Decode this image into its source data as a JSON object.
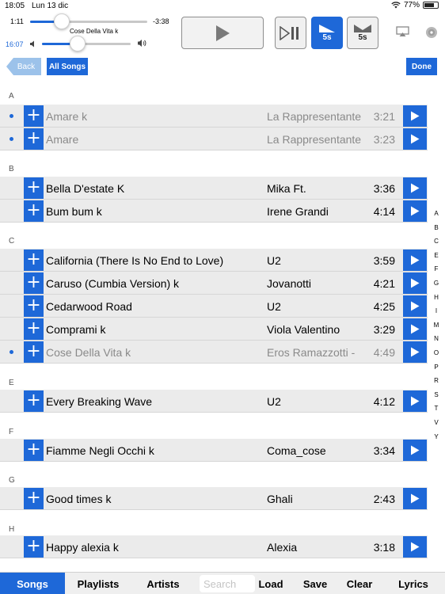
{
  "status": {
    "time": "18:05",
    "date": "Lun 13 dic",
    "battery": "77%",
    "battery_level": 0.77
  },
  "player": {
    "elapsed": "1:11",
    "remaining": "-3:38",
    "progress": 0.27,
    "now_playing": "Cose Della Vita k",
    "clock": "16:07",
    "volume": 0.4,
    "skip_back_label": "5s",
    "skip_forward_label": "5s"
  },
  "nav": {
    "back_label": "Back",
    "all_songs_label": "All Songs",
    "done_label": "Done"
  },
  "sections": [
    {
      "letter": "A",
      "songs": [
        {
          "title": "Amare k",
          "artist": "La Rappresentante",
          "duration": "3:21",
          "playing": true
        },
        {
          "title": "Amare",
          "artist": "La Rappresentante",
          "duration": "3:23",
          "playing": true
        }
      ]
    },
    {
      "letter": "B",
      "songs": [
        {
          "title": "Bella D'estate K",
          "artist": "Mika Ft.",
          "duration": "3:36",
          "playing": false
        },
        {
          "title": "Bum bum k",
          "artist": "Irene Grandi",
          "duration": "4:14",
          "playing": false
        }
      ]
    },
    {
      "letter": "C",
      "songs": [
        {
          "title": "California (There Is No End to Love)",
          "artist": "U2",
          "duration": "3:59",
          "playing": false
        },
        {
          "title": "Caruso (Cumbia Version) k",
          "artist": "Jovanotti",
          "duration": "4:21",
          "playing": false
        },
        {
          "title": "Cedarwood Road",
          "artist": "U2",
          "duration": "4:25",
          "playing": false
        },
        {
          "title": "Comprami k",
          "artist": "Viola Valentino",
          "duration": "3:29",
          "playing": false
        },
        {
          "title": "Cose Della Vita k",
          "artist": "Eros Ramazzotti -",
          "duration": "4:49",
          "playing": true
        }
      ]
    },
    {
      "letter": "E",
      "songs": [
        {
          "title": "Every Breaking Wave",
          "artist": "U2",
          "duration": "4:12",
          "playing": false
        }
      ]
    },
    {
      "letter": "F",
      "songs": [
        {
          "title": "Fiamme Negli Occhi k",
          "artist": "Coma_cose",
          "duration": "3:34",
          "playing": false
        }
      ]
    },
    {
      "letter": "G",
      "songs": [
        {
          "title": "Good times k",
          "artist": "Ghali",
          "duration": "2:43",
          "playing": false
        }
      ]
    },
    {
      "letter": "H",
      "songs": [
        {
          "title": "Happy alexia k",
          "artist": "Alexia",
          "duration": "3:18",
          "playing": false
        }
      ]
    }
  ],
  "index_letters": [
    "A",
    "B",
    "C",
    "E",
    "F",
    "G",
    "H",
    "I",
    "M",
    "N",
    "O",
    "P",
    "R",
    "S",
    "T",
    "V",
    "Y"
  ],
  "tabs": {
    "songs": "Songs",
    "playlists": "Playlists",
    "artists": "Artists",
    "search_placeholder": "Search",
    "load": "Load",
    "save": "Save",
    "clear": "Clear",
    "lyrics": "Lyrics"
  },
  "colors": {
    "accent": "#1e68d8",
    "row_bg": "#ebebeb",
    "dim_text": "#8a8a8a"
  }
}
